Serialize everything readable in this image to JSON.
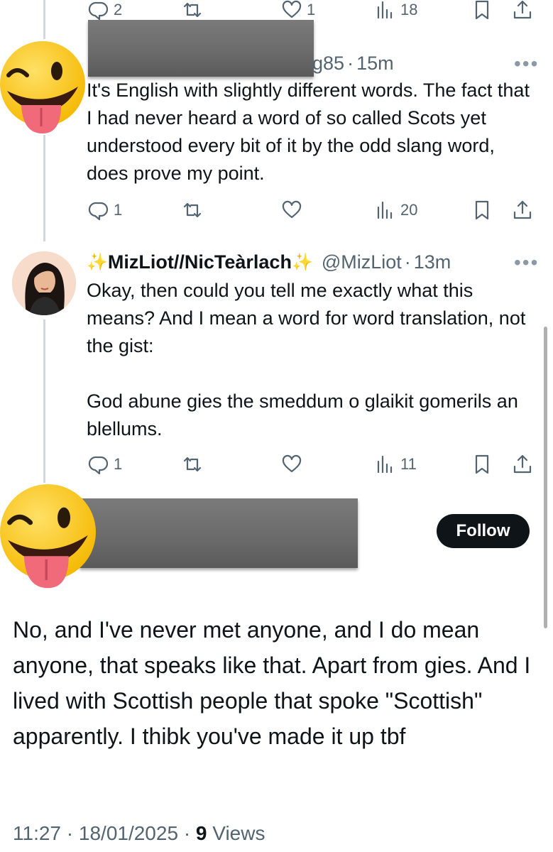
{
  "tweet1": {
    "replies": "2",
    "retweets": "",
    "likes": "1",
    "views": "18"
  },
  "tweet2": {
    "handle_suffix": "g85",
    "sep": "·",
    "time": "15m",
    "text": "It's English with slightly different words. The fact that I had never heard a word of so called Scots yet understood every bit of it by the odd slang word, does prove my point.",
    "replies": "1",
    "likes": "",
    "views": "20"
  },
  "tweet3": {
    "display_name": "MizLiot//NicTeàrlach",
    "sparkle": "✨",
    "handle": "@MizLiot",
    "sep": "·",
    "time": "13m",
    "text": "Okay, then could you tell me exactly what this means? And I mean a word for word translation, not the gist:\n\nGod abune gies the smeddum o glaikit gomerils an blellums.",
    "replies": "1",
    "likes": "",
    "views": "11"
  },
  "main": {
    "follow_label": "Follow",
    "text": "No, and I've never met anyone, and I do mean anyone, that speaks like that. Apart from gies. And I lived with Scottish people that spoke \"Scottish\" apparently. I thibk you've made it up tbf",
    "time": "11:27",
    "sep1": "·",
    "date": "18/01/2025",
    "sep2": "·",
    "views_count": "9",
    "views_label": "Views"
  },
  "more_label": "•••",
  "colors": {
    "text": "#0f1419",
    "secondary": "#536471",
    "line": "#cfd9de",
    "emoji": "#ffcc33"
  },
  "icons": [
    "reply-icon",
    "retweet-icon",
    "like-icon",
    "views-icon",
    "bookmark-icon",
    "share-icon",
    "more-icon",
    "wink-tongue-emoji"
  ]
}
